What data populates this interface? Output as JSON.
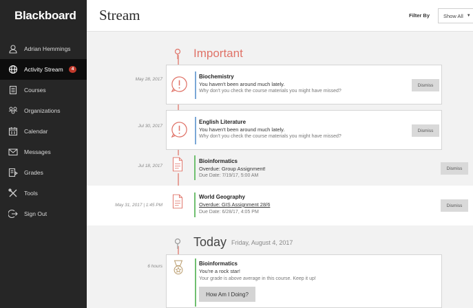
{
  "brand": "Blackboard",
  "sidebar": {
    "items": [
      {
        "label": "Adrian Hemmings",
        "icon": "user-icon"
      },
      {
        "label": "Activity Stream",
        "icon": "globe-icon",
        "badge": "4",
        "active": true
      },
      {
        "label": "Courses",
        "icon": "book-icon"
      },
      {
        "label": "Organizations",
        "icon": "people-icon"
      },
      {
        "label": "Calendar",
        "icon": "calendar-icon"
      },
      {
        "label": "Messages",
        "icon": "envelope-icon"
      },
      {
        "label": "Grades",
        "icon": "grades-icon"
      },
      {
        "label": "Tools",
        "icon": "tools-icon"
      },
      {
        "label": "Sign Out",
        "icon": "sign-out-icon"
      }
    ]
  },
  "header": {
    "title": "Stream",
    "filter_label": "Filter By",
    "filter_value": "Show All"
  },
  "important": {
    "title": "Important",
    "items": [
      {
        "date": "May 28, 2017",
        "course": "Biochemistry",
        "line1": "You haven't been around much lately.",
        "line2": "Why don't you check the course materials you might have missed?",
        "dismiss": "Dismiss"
      },
      {
        "date": "Jul 30, 2017",
        "course": "English Literature",
        "line1": "You haven't been around much lately.",
        "line2": "Why don't you check the course materials you might have missed?",
        "dismiss": "Dismiss"
      },
      {
        "date": "Jul 18, 2017",
        "course": "Bioinformatics",
        "line1": "Overdue: Group Assignment!",
        "line2": "Due Date: 7/19/17, 5:00 AM",
        "dismiss": "Dismiss"
      },
      {
        "date": "May 31, 2017 | 1:45 PM",
        "course": "World Geography",
        "line1": "Overdue: GIS Assignment 28/6",
        "line2": "Due Date: 6/28/17, 4:05 PM",
        "dismiss": "Dismiss"
      }
    ]
  },
  "today": {
    "title": "Today",
    "date": "Friday, August 4, 2017",
    "items": [
      {
        "date": "6 hours",
        "course": "Bioinformatics",
        "line1": "You're a rock star!",
        "line2": "Your grade is above average in this course. Keep it up!",
        "button": "How Am I Doing?"
      }
    ]
  }
}
